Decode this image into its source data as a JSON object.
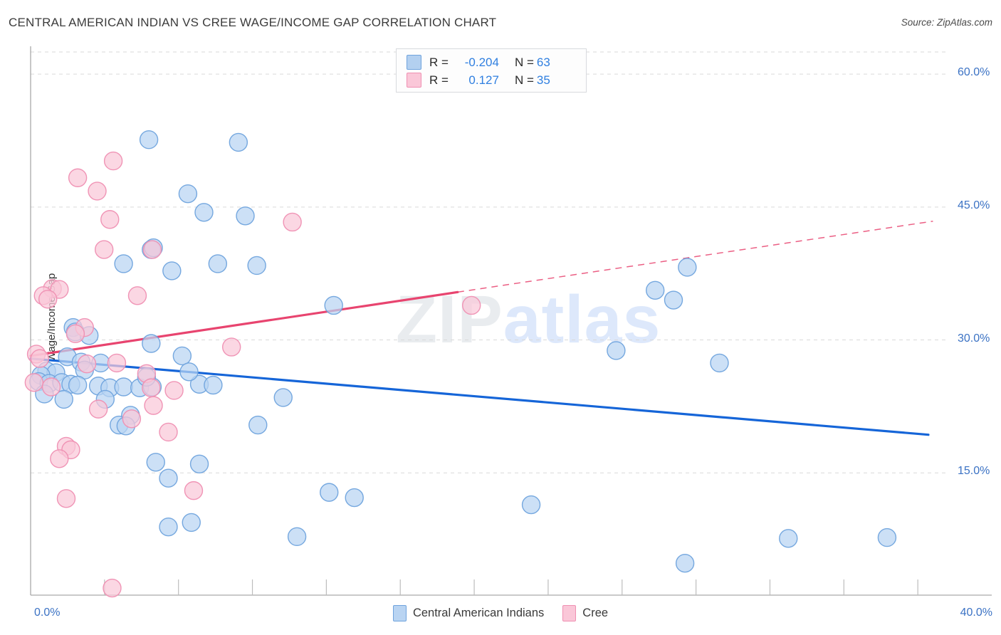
{
  "header": {
    "title": "CENTRAL AMERICAN INDIAN VS CREE WAGE/INCOME GAP CORRELATION CHART",
    "source": "Source: ZipAtlas.com"
  },
  "watermark": {
    "part1": "ZIP",
    "part2": "atlas"
  },
  "stat_legend": {
    "rows": [
      {
        "r_label": "R =",
        "r_value": "-0.204",
        "n_label": "N =",
        "n_value": "63",
        "color": "#b3d0f0"
      },
      {
        "r_label": "R =",
        "r_value": "0.127",
        "n_label": "N =",
        "n_value": "35",
        "color": "#fac7d8"
      }
    ]
  },
  "series_legend": [
    {
      "label": "Central American Indians",
      "color": "#b9d4f2"
    },
    {
      "label": "Cree",
      "color": "#fac7d8"
    }
  ],
  "chart_data": {
    "type": "scatter",
    "title": "CENTRAL AMERICAN INDIAN VS CREE WAGE/INCOME GAP CORRELATION CHART",
    "xlabel": "",
    "ylabel": "Wage/Income Gap",
    "xlim": [
      0.0,
      40.0
    ],
    "ylim": [
      1.2,
      62.5
    ],
    "xticks": [
      0.0,
      40.0
    ],
    "xtick_labels": [
      "0.0%",
      "40.0%"
    ],
    "yticks": [
      15.0,
      30.0,
      45.0,
      60.0
    ],
    "ytick_labels": [
      "15.0%",
      "30.0%",
      "45.0%",
      "60.0%"
    ],
    "grid": true,
    "legend_position": "bottom-center",
    "series": [
      {
        "name": "Central American Indians",
        "color": "#b9d4f2",
        "edge_color": "#6fa3dd",
        "R": -0.204,
        "N": 63,
        "trend": {
          "x0": 0.0,
          "y0": 27.9,
          "x1": 39.1,
          "y1": 19.3,
          "style": "solid",
          "color": "#1565d8"
        },
        "points": [
          [
            5.15,
            52.6
          ],
          [
            9.05,
            52.3
          ],
          [
            6.85,
            46.5
          ],
          [
            7.55,
            44.4
          ],
          [
            9.35,
            44.0
          ],
          [
            5.25,
            40.2
          ],
          [
            5.35,
            40.4
          ],
          [
            4.05,
            38.6
          ],
          [
            8.15,
            38.6
          ],
          [
            9.85,
            38.4
          ],
          [
            6.15,
            37.8
          ],
          [
            13.2,
            33.9
          ],
          [
            28.6,
            38.2
          ],
          [
            27.2,
            35.6
          ],
          [
            28.0,
            34.5
          ],
          [
            1.85,
            31.4
          ],
          [
            1.95,
            30.9
          ],
          [
            2.55,
            30.5
          ],
          [
            5.25,
            29.6
          ],
          [
            6.6,
            28.2
          ],
          [
            1.6,
            28.1
          ],
          [
            2.2,
            27.5
          ],
          [
            3.05,
            27.4
          ],
          [
            2.35,
            26.6
          ],
          [
            0.7,
            26.5
          ],
          [
            1.1,
            26.3
          ],
          [
            0.45,
            26.0
          ],
          [
            0.35,
            25.3
          ],
          [
            0.8,
            25.1
          ],
          [
            1.35,
            25.2
          ],
          [
            1.75,
            25.0
          ],
          [
            2.05,
            24.9
          ],
          [
            2.95,
            24.8
          ],
          [
            3.45,
            24.6
          ],
          [
            4.05,
            24.7
          ],
          [
            4.75,
            24.6
          ],
          [
            5.3,
            24.7
          ],
          [
            5.05,
            25.8
          ],
          [
            7.35,
            25.0
          ],
          [
            7.95,
            24.9
          ],
          [
            6.9,
            26.4
          ],
          [
            0.6,
            23.9
          ],
          [
            1.45,
            23.3
          ],
          [
            3.25,
            23.3
          ],
          [
            11.0,
            23.5
          ],
          [
            25.5,
            28.8
          ],
          [
            30.0,
            27.4
          ],
          [
            4.35,
            21.5
          ],
          [
            3.85,
            20.4
          ],
          [
            4.15,
            20.3
          ],
          [
            9.9,
            20.4
          ],
          [
            5.45,
            16.2
          ],
          [
            7.35,
            16.0
          ],
          [
            6.0,
            14.4
          ],
          [
            13.0,
            12.8
          ],
          [
            14.1,
            12.2
          ],
          [
            21.8,
            11.4
          ],
          [
            6.0,
            8.9
          ],
          [
            7.0,
            9.4
          ],
          [
            11.6,
            7.8
          ],
          [
            33.0,
            7.6
          ],
          [
            37.3,
            7.7
          ],
          [
            28.5,
            4.8
          ]
        ]
      },
      {
        "name": "Cree",
        "color": "#fac7d8",
        "edge_color": "#ef8fb2",
        "R": 0.127,
        "N": 35,
        "trend": {
          "x0": 0.0,
          "y0": 28.2,
          "x1": 18.6,
          "y1": 35.4,
          "style": "solid",
          "color": "#e8446f"
        },
        "trend_extension": {
          "x0": 18.6,
          "y0": 35.4,
          "x1": 39.3,
          "y1": 43.4,
          "style": "dashed",
          "color": "#e8446f"
        },
        "points": [
          [
            3.6,
            50.2
          ],
          [
            2.05,
            48.3
          ],
          [
            2.9,
            46.8
          ],
          [
            3.45,
            43.6
          ],
          [
            11.4,
            43.3
          ],
          [
            3.2,
            40.2
          ],
          [
            5.3,
            40.2
          ],
          [
            0.95,
            35.8
          ],
          [
            1.25,
            35.7
          ],
          [
            0.55,
            35.0
          ],
          [
            0.75,
            34.6
          ],
          [
            4.65,
            35.0
          ],
          [
            19.2,
            33.9
          ],
          [
            2.35,
            31.4
          ],
          [
            1.95,
            30.7
          ],
          [
            8.75,
            29.2
          ],
          [
            0.25,
            28.4
          ],
          [
            0.4,
            27.9
          ],
          [
            2.45,
            27.3
          ],
          [
            3.75,
            27.4
          ],
          [
            5.05,
            26.2
          ],
          [
            0.15,
            25.2
          ],
          [
            0.9,
            24.7
          ],
          [
            5.25,
            24.6
          ],
          [
            6.25,
            24.3
          ],
          [
            5.35,
            22.6
          ],
          [
            2.95,
            22.2
          ],
          [
            4.4,
            21.1
          ],
          [
            1.55,
            18.0
          ],
          [
            1.75,
            17.6
          ],
          [
            1.25,
            16.6
          ],
          [
            6.0,
            19.6
          ],
          [
            7.1,
            13.0
          ],
          [
            1.55,
            12.1
          ],
          [
            3.55,
            2.0
          ]
        ]
      }
    ]
  }
}
